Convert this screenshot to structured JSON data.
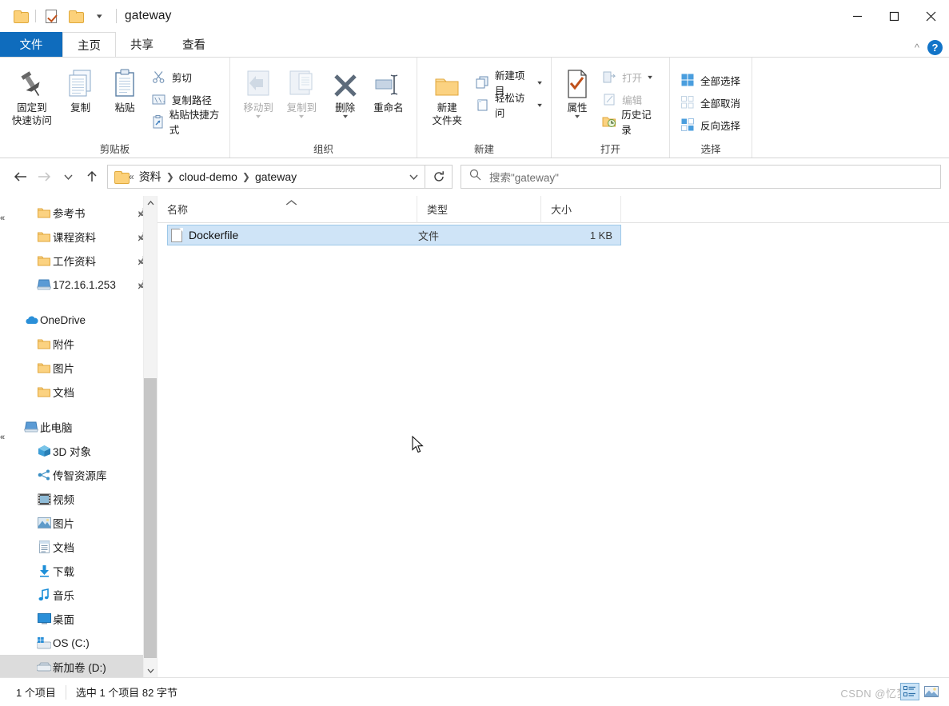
{
  "window": {
    "title": "gateway",
    "quick_access": [
      {
        "name": "folder-icon",
        "label": "folder"
      },
      {
        "name": "properties-icon",
        "label": "properties"
      },
      {
        "name": "new-folder-icon",
        "label": "new folder"
      }
    ],
    "controls": {
      "minimize": "minimize",
      "maximize": "maximize",
      "close": "close"
    }
  },
  "tabs": [
    {
      "label": "文件",
      "name": "tab-file"
    },
    {
      "label": "主页",
      "name": "tab-home"
    },
    {
      "label": "共享",
      "name": "tab-share"
    },
    {
      "label": "查看",
      "name": "tab-view"
    }
  ],
  "ribbon": {
    "collapse_label": "^",
    "help_label": "?",
    "groups": [
      {
        "title": "剪贴板",
        "big": [
          {
            "label": "固定到\n快速访问",
            "line1": "固定到",
            "line2": "快速访问",
            "icon": "pin-icon"
          },
          {
            "label": "复制",
            "line1": "复制",
            "line2": "",
            "icon": "copy-icon"
          },
          {
            "label": "粘贴",
            "line1": "粘贴",
            "line2": "",
            "icon": "paste-icon"
          }
        ],
        "small": [
          {
            "label": "剪切",
            "icon": "scissors-icon",
            "disabled": false
          },
          {
            "label": "复制路径",
            "icon": "copy-path-icon",
            "disabled": false
          },
          {
            "label": "粘贴快捷方式",
            "icon": "paste-shortcut-icon",
            "disabled": false
          }
        ]
      },
      {
        "title": "组织",
        "big": [
          {
            "line1": "移动到",
            "line2": "",
            "icon": "move-to-icon",
            "disabled": true,
            "caret": true
          },
          {
            "line1": "复制到",
            "line2": "",
            "icon": "copy-to-icon",
            "disabled": true,
            "caret": true
          },
          {
            "line1": "删除",
            "line2": "",
            "icon": "delete-icon",
            "disabled": false,
            "caret": true
          },
          {
            "line1": "重命名",
            "line2": "",
            "icon": "rename-icon",
            "disabled": false,
            "caret": false
          }
        ],
        "small": []
      },
      {
        "title": "新建",
        "big": [
          {
            "line1": "新建",
            "line2": "文件夹",
            "icon": "new-folder-icon"
          }
        ],
        "small": [
          {
            "label": "新建项目",
            "icon": "new-item-icon",
            "caret": true
          },
          {
            "label": "轻松访问",
            "icon": "easy-access-icon",
            "caret": true
          }
        ]
      },
      {
        "title": "打开",
        "big": [
          {
            "line1": "属性",
            "line2": "",
            "icon": "properties-icon",
            "caret": true
          }
        ],
        "small": [
          {
            "label": "打开",
            "icon": "open-icon",
            "caret": true,
            "disabled": true
          },
          {
            "label": "编辑",
            "icon": "edit-icon",
            "disabled": true
          },
          {
            "label": "历史记录",
            "icon": "history-icon",
            "disabled": false
          }
        ]
      },
      {
        "title": "选择",
        "big": [],
        "small": [
          {
            "label": "全部选择",
            "icon": "select-all-icon"
          },
          {
            "label": "全部取消",
            "icon": "select-none-icon",
            "disabled": true
          },
          {
            "label": "反向选择",
            "icon": "invert-selection-icon"
          }
        ]
      }
    ]
  },
  "address": {
    "back": "back",
    "forward": "forward",
    "recent": "recent-locations",
    "up": "up",
    "crumbs": [
      "«",
      "资料",
      "cloud-demo",
      "gateway"
    ],
    "dropdown": "path-dropdown",
    "refresh": "refresh",
    "search_placeholder": "搜索\"gateway\""
  },
  "navigation": {
    "items": [
      {
        "label": "参考书",
        "icon": "folder-icon",
        "indent": 2,
        "pinned": true,
        "selected": false
      },
      {
        "label": "课程资料",
        "icon": "folder-icon",
        "indent": 2,
        "pinned": true,
        "selected": false
      },
      {
        "label": "工作资料",
        "icon": "folder-icon",
        "indent": 2,
        "pinned": true,
        "selected": false
      },
      {
        "label": "172.16.1.253",
        "icon": "computer-icon",
        "indent": 2,
        "pinned": true,
        "selected": false
      },
      {
        "label": "",
        "icon": "gap",
        "indent": 0,
        "pinned": false,
        "selected": false
      },
      {
        "label": "OneDrive",
        "icon": "onedrive-icon",
        "indent": 1,
        "pinned": false,
        "selected": false
      },
      {
        "label": "附件",
        "icon": "folder-icon",
        "indent": 2,
        "pinned": false,
        "selected": false
      },
      {
        "label": "图片",
        "icon": "folder-icon",
        "indent": 2,
        "pinned": false,
        "selected": false
      },
      {
        "label": "文档",
        "icon": "folder-icon",
        "indent": 2,
        "pinned": false,
        "selected": false
      },
      {
        "label": "",
        "icon": "gap",
        "indent": 0,
        "pinned": false,
        "selected": false
      },
      {
        "label": "此电脑",
        "icon": "computer-icon",
        "indent": 1,
        "pinned": false,
        "selected": false
      },
      {
        "label": "3D 对象",
        "icon": "3d-objects-icon",
        "indent": 2,
        "pinned": false,
        "selected": false
      },
      {
        "label": "传智资源库",
        "icon": "network-share-icon",
        "indent": 2,
        "pinned": false,
        "selected": false
      },
      {
        "label": "视频",
        "icon": "videos-icon",
        "indent": 2,
        "pinned": false,
        "selected": false
      },
      {
        "label": "图片",
        "icon": "pictures-icon",
        "indent": 2,
        "pinned": false,
        "selected": false
      },
      {
        "label": "文档",
        "icon": "documents-icon",
        "indent": 2,
        "pinned": false,
        "selected": false
      },
      {
        "label": "下载",
        "icon": "downloads-icon",
        "indent": 2,
        "pinned": false,
        "selected": false
      },
      {
        "label": "音乐",
        "icon": "music-icon",
        "indent": 2,
        "pinned": false,
        "selected": false
      },
      {
        "label": "桌面",
        "icon": "desktop-icon",
        "indent": 2,
        "pinned": false,
        "selected": false
      },
      {
        "label": "OS (C:)",
        "icon": "windows-drive-icon",
        "indent": 2,
        "pinned": false,
        "selected": false
      },
      {
        "label": "新加卷 (D:)",
        "icon": "drive-icon",
        "indent": 2,
        "pinned": false,
        "selected": true
      }
    ]
  },
  "file_list": {
    "columns": [
      {
        "label": "名称",
        "sorted": true
      },
      {
        "label": "类型",
        "sorted": false
      },
      {
        "label": "大小",
        "sorted": false
      }
    ],
    "rows": [
      {
        "name": "Dockerfile",
        "type": "文件",
        "size": "1 KB",
        "icon": "file-icon",
        "selected": true
      }
    ]
  },
  "status_bar": {
    "item_count": "1 个项目",
    "selection": "选中 1 个项目  82 字节",
    "watermark": "CSDN @忆梦",
    "views": [
      {
        "name": "details-view-button",
        "active": true
      },
      {
        "name": "large-icons-view-button",
        "active": false
      }
    ]
  },
  "colors": {
    "accent": "#0f6cbd",
    "selection_fill": "#cfe4f7",
    "selection_border": "#9dc8e8",
    "nav_selected": "#dcdcdc",
    "folder_yellow": "#fcd17a"
  }
}
